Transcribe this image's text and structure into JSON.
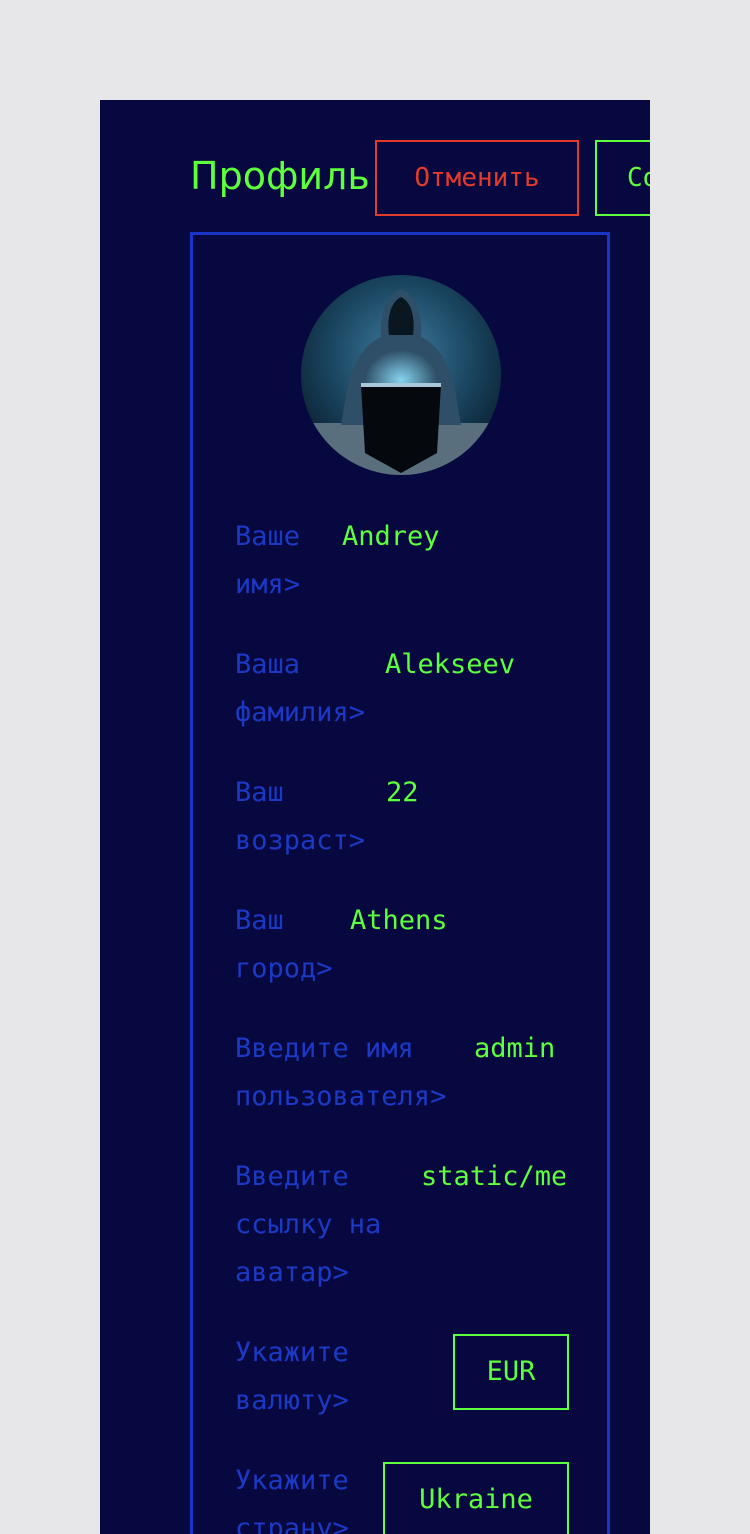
{
  "header": {
    "title": "Профиль",
    "cancel_label": "Отменить",
    "save_label": "Сохранить"
  },
  "colors": {
    "background": "#080840",
    "accent": "#5eff3c",
    "label": "#1b39c4",
    "danger": "#e13b2c",
    "border": "#1836c6"
  },
  "profile": {
    "avatar_icon": "hooded-hacker-avatar",
    "fields": [
      {
        "label": "Ваше\nимя>",
        "value": "Andrey"
      },
      {
        "label": "Ваша\nфамилия>",
        "value": "Alekseev"
      },
      {
        "label": "Ваш\nвозраст>",
        "value": "22"
      },
      {
        "label": "Ваш\nгород>",
        "value": "Athens"
      },
      {
        "label": "Введите имя\nпользователя>",
        "value": "admin"
      },
      {
        "label": "Введите\nссылку на\nаватар>",
        "value": "static/media/avatar.jpg"
      }
    ],
    "currency": {
      "label": "Укажите\nвалюту>",
      "value": "EUR"
    },
    "country": {
      "label": "Укажите\nстрану>",
      "value": "Ukraine"
    }
  }
}
